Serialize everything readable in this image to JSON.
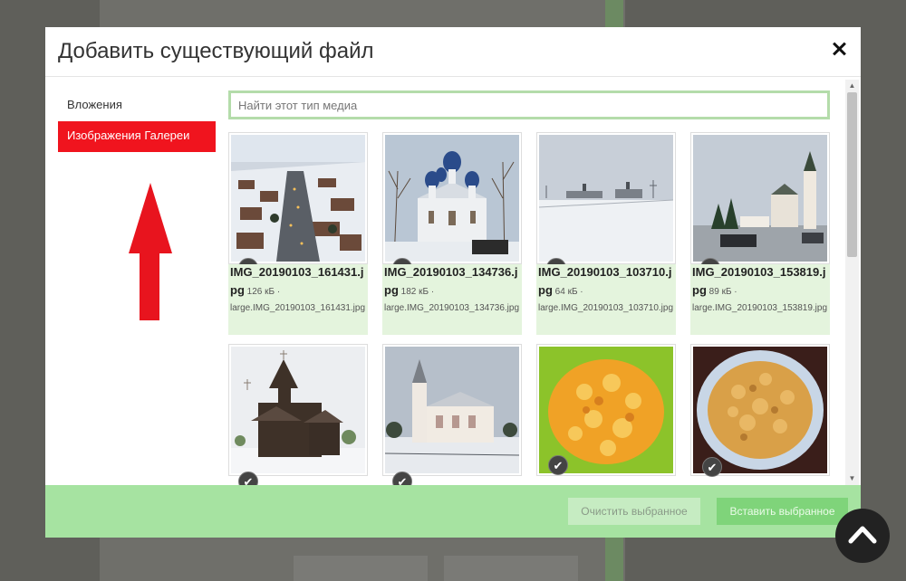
{
  "modal": {
    "title": "Добавить существующий файл"
  },
  "sidebar": {
    "items": [
      {
        "label": "Вложения",
        "active": false
      },
      {
        "label": "Изображения Галереи",
        "active": true
      }
    ]
  },
  "search": {
    "placeholder": "Найти этот тип медиа"
  },
  "media": [
    {
      "name": "IMG_20190103_161431.jpg",
      "size": "126 кБ ·",
      "large": "large.IMG_20190103_161431.jpg",
      "checked": true
    },
    {
      "name": "IMG_20190103_134736.jpg",
      "size": "182 кБ ·",
      "large": "large.IMG_20190103_134736.jpg",
      "checked": true
    },
    {
      "name": "IMG_20190103_103710.jpg",
      "size": "64 кБ ·",
      "large": "large.IMG_20190103_103710.jpg",
      "checked": true
    },
    {
      "name": "IMG_20190103_153819.jpg",
      "size": "89 кБ ·",
      "large": "large.IMG_20190103_153819.jpg",
      "checked": true
    },
    {
      "name": "",
      "size": "",
      "large": "",
      "checked": true
    },
    {
      "name": "",
      "size": "",
      "large": "",
      "checked": true
    },
    {
      "name": "",
      "size": "",
      "large": "",
      "checked": true
    },
    {
      "name": "",
      "size": "",
      "large": "",
      "checked": true
    }
  ],
  "footer": {
    "clear_label": "Очистить выбранное",
    "insert_label": "Вставить выбранное"
  },
  "colors": {
    "active_tab": "#f0141e",
    "footer": "#a6e3a1",
    "caption_bg": "#e4f4dd",
    "arrow": "#e8141e"
  }
}
